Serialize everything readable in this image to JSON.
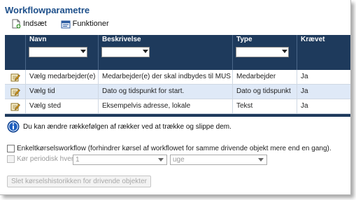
{
  "title": "Workflowparametre",
  "toolbar": {
    "insert_label": "Indsæt",
    "insert_icon": "add-document-icon",
    "functions_label": "Funktioner",
    "functions_icon": "functions-icon"
  },
  "grid": {
    "columns": [
      "Navn",
      "Beskrivelse",
      "Type",
      "Krævet"
    ],
    "rows": [
      {
        "navn": "Vælg medarbejder(e)",
        "beskrivelse": "Medarbejder(e) der skal indbydes til MUS",
        "type": "Medarbejder",
        "kraevet": "Ja"
      },
      {
        "navn": "Vælg tid",
        "beskrivelse": "Dato og tidspunkt for start.",
        "type": "Dato og tidspunkt",
        "kraevet": "Ja"
      },
      {
        "navn": "Vælg sted",
        "beskrivelse": "Eksempelvis adresse, lokale",
        "type": "Tekst",
        "kraevet": "Ja"
      }
    ]
  },
  "info_text": "Du kan ændre rækkefølgen af rækker ved at trække og slippe dem.",
  "single_run_label": "Enkeltkørselsworkflow (forhindrer kørsel af workflowet for samme drivende objekt mere end en gang).",
  "periodic_label": "Kør periodisk hver",
  "periodic_value": "1",
  "periodic_unit": "uge",
  "clear_button_label": "Slet kørselshistorikken for drivende objekter",
  "colors": {
    "title": "#1d4f8a",
    "header_bg": "#1e3a5c",
    "selected_row": "#dfe9f7"
  }
}
